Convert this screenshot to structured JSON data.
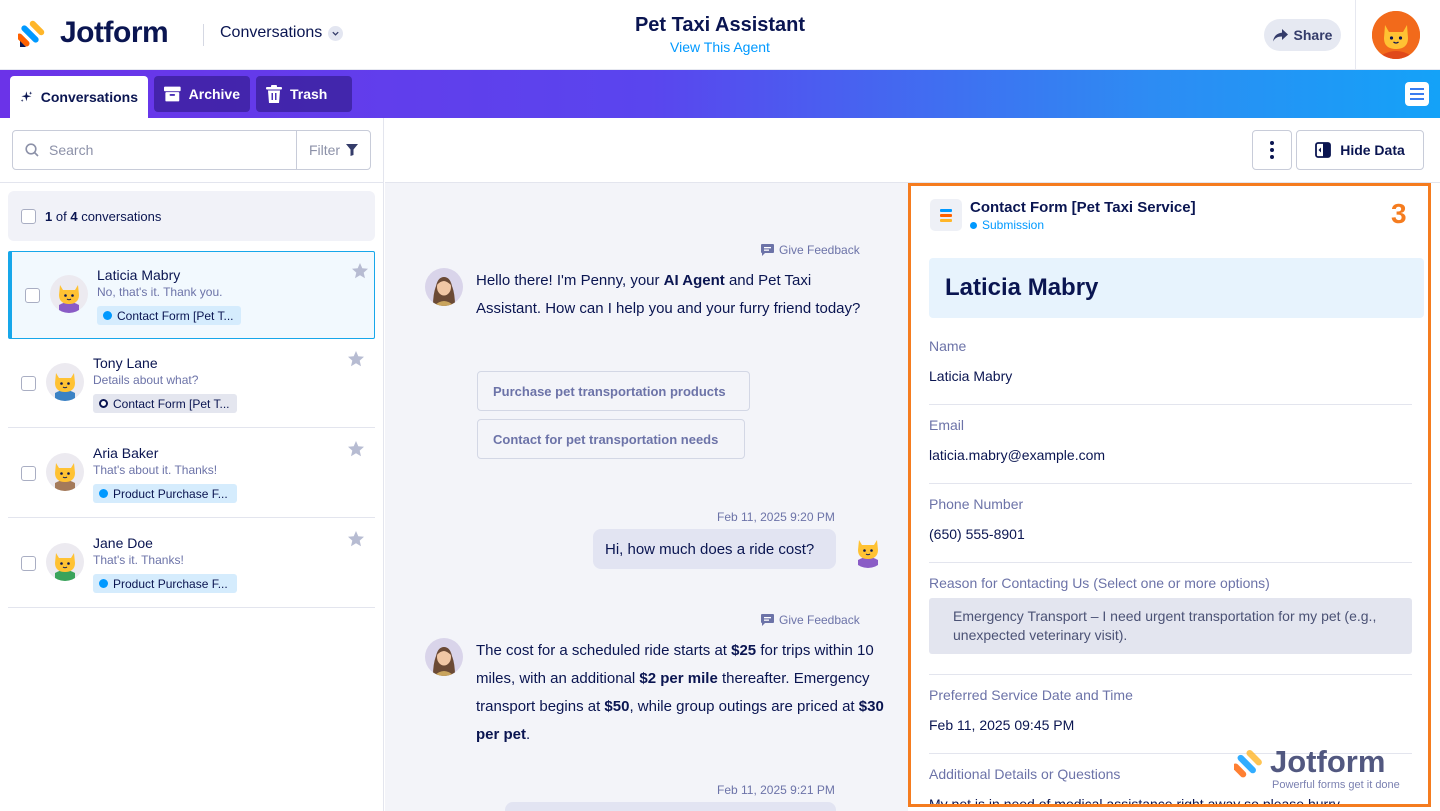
{
  "header": {
    "brand": "Jotform",
    "section_dropdown": "Conversations",
    "title": "Pet Taxi Assistant",
    "subtitle_link": "View This Agent",
    "share_label": "Share"
  },
  "tabs": [
    {
      "label": "Conversations",
      "icon": "sparkle-icon",
      "active": true
    },
    {
      "label": "Archive",
      "icon": "archive-icon",
      "active": false
    },
    {
      "label": "Trash",
      "icon": "trash-icon",
      "active": false
    }
  ],
  "sidebar": {
    "search_placeholder": "Search",
    "filter_label": "Filter",
    "count_number_selected": "1",
    "count_of": "of",
    "count_number_total": "4",
    "count_suffix": "conversations",
    "conversations": [
      {
        "name": "Laticia Mabry",
        "preview": "No, that's it. Thank you.",
        "tag": "Contact Form [Pet T...",
        "selected": true,
        "avatar_color": "#8a5cc6"
      },
      {
        "name": "Tony Lane",
        "preview": "Details about what?",
        "tag": "Contact Form [Pet T...",
        "selected": false,
        "avatar_color": "#3b82c4"
      },
      {
        "name": "Aria Baker",
        "preview": "That's about it. Thanks!",
        "tag": "Product Purchase F...",
        "selected": false,
        "avatar_color": "#a47a5a"
      },
      {
        "name": "Jane Doe",
        "preview": "That's it. Thanks!",
        "tag": "Product Purchase F...",
        "selected": false,
        "avatar_color": "#3aa35b"
      }
    ]
  },
  "toolbar": {
    "hide_data_label": "Hide Data"
  },
  "chat": {
    "feedback_label": "Give Feedback",
    "messages": [
      {
        "from": "agent",
        "parts": [
          "Hello there! I'm Penny, your ",
          "AI Agent",
          " and Pet Taxi Assistant. How can I help you and your furry friend today?"
        ]
      },
      {
        "from": "user",
        "timestamp": "Feb 11, 2025 9:20 PM",
        "text": "Hi, how much does a ride cost?"
      },
      {
        "from": "agent",
        "parts": [
          "The cost for a scheduled ride starts at ",
          "$25",
          " for trips within 10 miles, with an additional ",
          "$2 per mile",
          " thereafter. Emergency transport begins at ",
          "$50",
          ", while group outings are priced at ",
          "$30 per pet",
          "."
        ]
      },
      {
        "from": "user",
        "timestamp": "Feb 11, 2025 9:21 PM",
        "text": ""
      }
    ],
    "suggestions": [
      "Purchase pet transportation products",
      "Contact for pet transportation needs"
    ]
  },
  "submission": {
    "form_title": "Contact Form [Pet Taxi Service]",
    "form_type": "Submission",
    "badge_number": "3",
    "person_name": "Laticia Mabry",
    "fields": [
      {
        "label": "Name",
        "value": "Laticia Mabry"
      },
      {
        "label": "Email",
        "value": "laticia.mabry@example.com"
      },
      {
        "label": "Phone Number",
        "value": "(650) 555-8901"
      },
      {
        "label": "Reason for Contacting Us (Select one or more options)",
        "value": "Emergency Transport – I need urgent transportation for my pet (e.g., unexpected veterinary visit)."
      },
      {
        "label": "Preferred Service Date and Time",
        "value": "Feb 11, 2025 09:45 PM"
      },
      {
        "label": "Additional Details or Questions",
        "value": "My pet is in need of medical assistance right away so please hurry"
      }
    ]
  },
  "watermark": {
    "brand": "Jotform",
    "tagline": "Powerful forms get it done"
  },
  "colors": {
    "accent_orange": "#f57c1f",
    "link_blue": "#0099ff",
    "navy": "#0a1551"
  }
}
